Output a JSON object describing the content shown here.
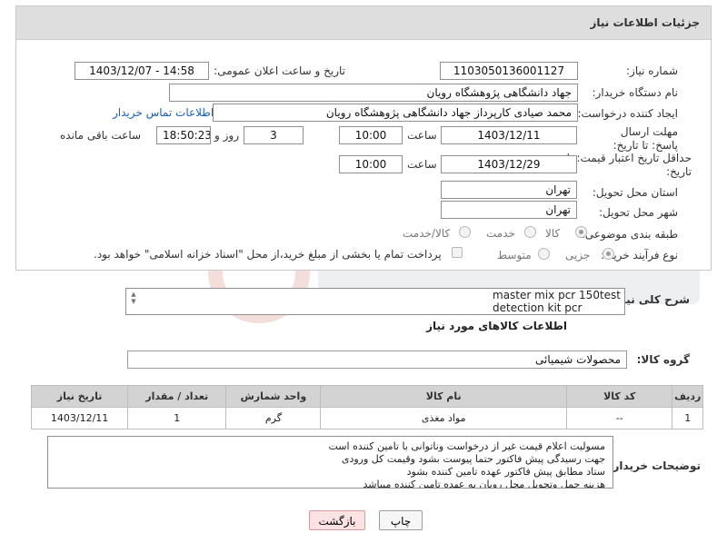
{
  "panel": {
    "title": "جزئیات اطلاعات نیاز"
  },
  "need_number": {
    "label": "شماره نیاز:",
    "value": "1103050136001127"
  },
  "announce_datetime": {
    "label": "تاریخ و ساعت اعلان عمومی:",
    "value": "1403/12/07 - 14:58"
  },
  "buyer_org": {
    "label": "نام دستگاه خریدار:",
    "value": "جهاد دانشگاهی پژوهشگاه رویان"
  },
  "requester": {
    "label": "ایجاد کننده درخواست:",
    "value": "محمد صیادی کارپرداز جهاد دانشگاهی پژوهشگاه رویان",
    "contact_link": "اطلاعات تماس خریدار"
  },
  "reply_deadline": {
    "label": "مهلت ارسال پاسخ: تا تاریخ:",
    "date": "1403/12/11",
    "time_label": "ساعت",
    "time": "10:00",
    "days": "3",
    "days_label": "روز و",
    "remaining": "18:50:23",
    "remaining_label": "ساعت باقی مانده"
  },
  "price_validity": {
    "label": "حداقل تاریخ اعتبار قیمت: تا تاریخ:",
    "date": "1403/12/29",
    "time_label": "ساعت",
    "time": "10:00"
  },
  "province": {
    "label": "استان محل تحویل:",
    "value": "تهران"
  },
  "city": {
    "label": "شهر محل تحویل:",
    "value": "تهران"
  },
  "category": {
    "label": "طبقه بندی موضوعی:",
    "options": [
      "کالا",
      "خدمت",
      "کالا/خدمت"
    ]
  },
  "purchase_type": {
    "label": "نوع فرآیند خرید :",
    "options": [
      "جزیی",
      "متوسط"
    ],
    "payment_note": "پرداخت تمام یا بخشی از مبلغ خرید،از محل \"اسناد خزانه اسلامی\" خواهد بود."
  },
  "description": {
    "label": "شرح کلی نیاز:",
    "lines": [
      "master mix pcr 150test",
      "detection kit pcr"
    ]
  },
  "goods_info": {
    "title": "اطلاعات کالاهای مورد نیاز"
  },
  "goods_group": {
    "label": "گروه کالا:",
    "value": "محصولات شیمیائی"
  },
  "table": {
    "headers": [
      "ردیف",
      "کد کالا",
      "نام کالا",
      "واحد شمارش",
      "تعداد / مقدار",
      "تاریخ نیاز"
    ],
    "rows": [
      {
        "index": "1",
        "code": "--",
        "name": "مواد مغذی",
        "unit": "گرم",
        "qty": "1",
        "date": "1403/12/11"
      }
    ]
  },
  "buyer_notes": {
    "label": "توضیحات خریدار:",
    "lines": [
      "مسولیت اعلام قیمت  غیر از درخواست وناتوانی با تامین کننده است",
      "جهت رسیدگی پیش فاکتور حتما پیوست بشود وقیمت کل ورودی",
      "ستاد مطابق پیش فاکتور عهده تامین کننده بشود",
      "هزینه حمل وتحویل محل رویان به عهده تامین کننده میباشد"
    ]
  },
  "buttons": {
    "print": "چاپ",
    "back": "بازگشت"
  },
  "colors": {
    "header_bg": "#dedede",
    "link": "#1a5fb4",
    "back_button": "#fde2e4"
  }
}
